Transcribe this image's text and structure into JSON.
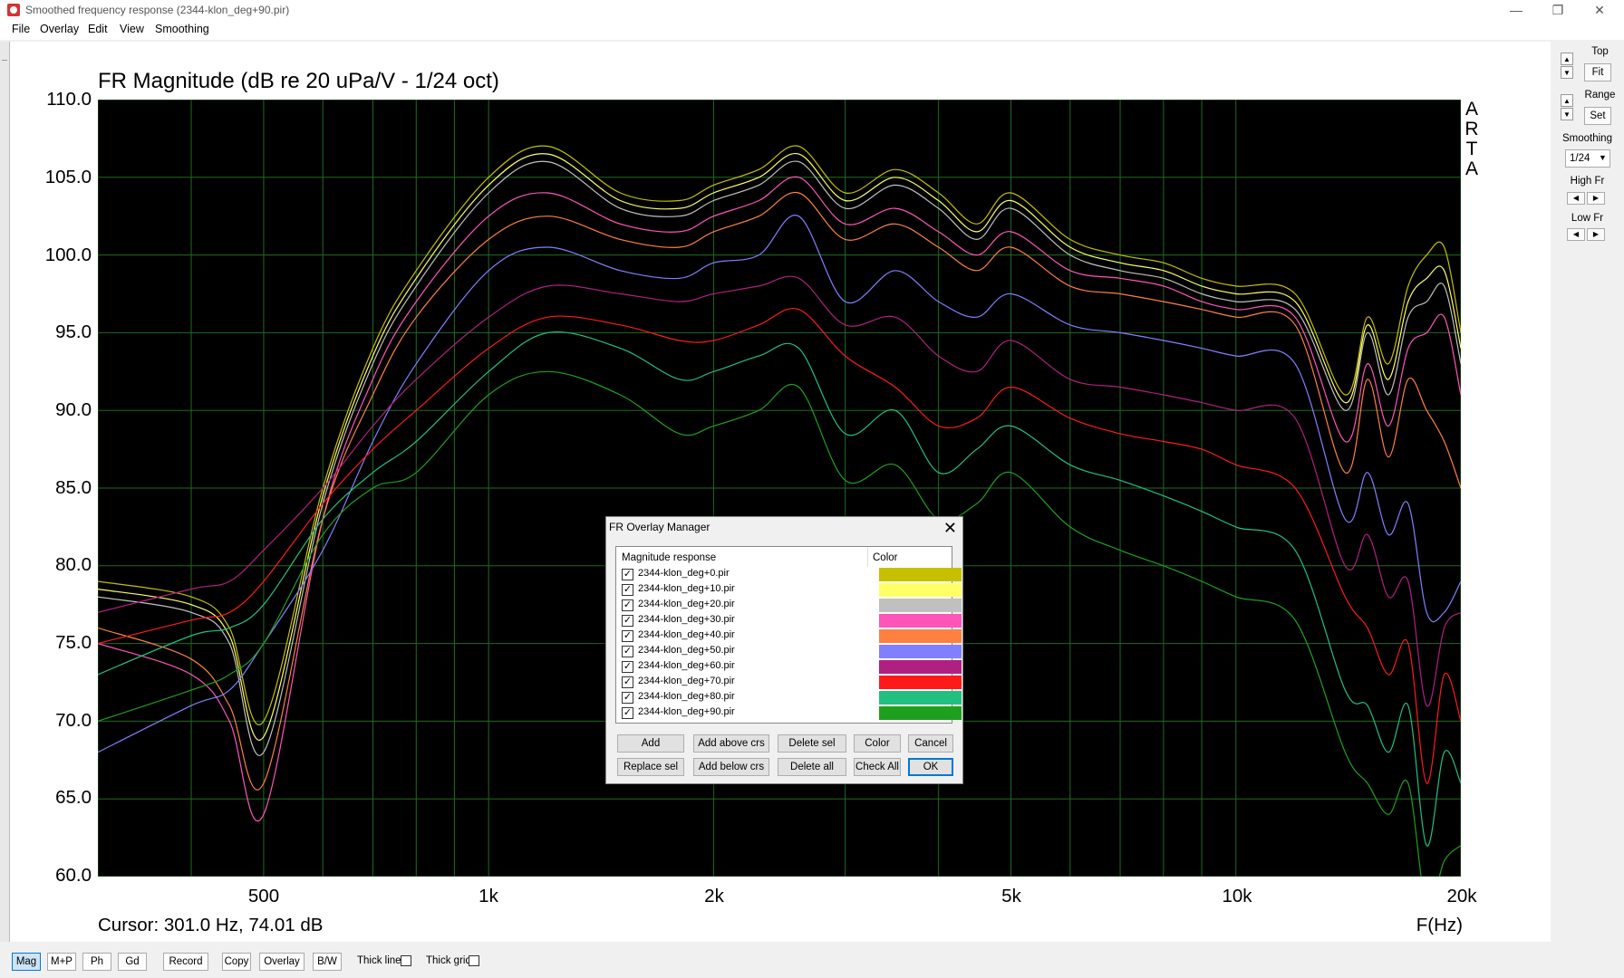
{
  "window": {
    "title": "Smoothed frequency response (2344-klon_deg+90.pir)",
    "minimize": "—",
    "restore": "❐",
    "close": "✕"
  },
  "menu": [
    "File",
    "Overlay",
    "Edit",
    "View",
    "Smoothing"
  ],
  "graph": {
    "title": "FR Magnitude (dB re 20 uPa/V - 1/24 oct)",
    "watermark": [
      "A",
      "R",
      "T",
      "A"
    ],
    "cursor_readout": "Cursor: 301.0 Hz, 74.01 dB",
    "x_unit": "F(Hz)"
  },
  "chart_data": {
    "type": "line",
    "title": "FR Magnitude (dB re 20 uPa/V - 1/24 oct)",
    "xlabel": "F(Hz)",
    "ylabel": "",
    "x_scale": "log",
    "xlim": [
      300,
      20000
    ],
    "ylim": [
      60,
      110
    ],
    "y_ticks": [
      "110.0",
      "105.0",
      "100.0",
      "95.0",
      "90.0",
      "85.0",
      "80.0",
      "75.0",
      "70.0",
      "65.0",
      "60.0"
    ],
    "x_ticks": [
      {
        "value": 500,
        "label": "500"
      },
      {
        "value": 1000,
        "label": "1k"
      },
      {
        "value": 2000,
        "label": "2k"
      },
      {
        "value": 5000,
        "label": "5k"
      },
      {
        "value": 10000,
        "label": "10k"
      },
      {
        "value": 20000,
        "label": "20k"
      }
    ],
    "grid": true,
    "background": "#000000",
    "grid_color": "#1f6b1f",
    "x": [
      300,
      400,
      450,
      500,
      600,
      700,
      800,
      1000,
      1200,
      1500,
      1800,
      2000,
      2300,
      2600,
      3000,
      3500,
      4000,
      4500,
      5000,
      6000,
      7000,
      8000,
      9000,
      10000,
      12000,
      14000,
      15000,
      16000,
      17000,
      18000,
      19000,
      20000
    ],
    "series": [
      {
        "name": "2344-klon_deg+0.pir",
        "color": "#c6c000",
        "values": [
          79,
          78,
          76,
          70,
          85,
          94,
          99,
          105,
          107,
          104,
          103.5,
          104.5,
          105.5,
          107,
          104,
          105.5,
          104,
          102,
          104,
          101,
          100,
          99.5,
          98.5,
          98,
          97.5,
          91,
          96,
          93,
          98,
          100,
          100.5,
          95
        ]
      },
      {
        "name": "2344-klon_deg+10.pir",
        "color": "#ffff66",
        "values": [
          78.5,
          77.5,
          75.5,
          69,
          84.5,
          93.5,
          98.5,
          104.5,
          106.5,
          103.5,
          103,
          104,
          105,
          106.5,
          103.5,
          105,
          103.5,
          101.5,
          103.5,
          100.5,
          99.5,
          99,
          98,
          97.5,
          97,
          90.5,
          95.5,
          92,
          97,
          98.5,
          99,
          94
        ]
      },
      {
        "name": "2344-klon_deg+20.pir",
        "color": "#c0c0c0",
        "values": [
          78,
          77,
          75,
          68,
          84,
          93,
          98,
          104,
          106,
          103,
          102.5,
          103.5,
          104.5,
          106,
          103,
          104.5,
          103,
          101,
          103,
          100,
          99,
          98.5,
          97.5,
          97,
          96.5,
          90,
          95,
          91,
          96,
          97,
          98,
          93
        ]
      },
      {
        "name": "2344-klon_deg+30.pir",
        "color": "#ff55bb",
        "values": [
          75,
          73,
          70,
          64,
          83,
          92,
          97,
          102.5,
          104,
          102,
          101.5,
          102.5,
          103.5,
          105,
          102,
          103,
          101.5,
          100,
          101.5,
          99,
          98.5,
          98,
          97,
          96.5,
          96,
          88,
          93,
          89,
          94,
          95,
          96,
          91
        ]
      },
      {
        "name": "2344-klon_deg+40.pir",
        "color": "#ff8040",
        "values": [
          76,
          74,
          71,
          66,
          83,
          91,
          96,
          101,
          102.5,
          101,
          100.5,
          101.5,
          102.5,
          104,
          101,
          102,
          100.5,
          99,
          100.5,
          98,
          97.5,
          97,
          96.5,
          96,
          95.5,
          86,
          92,
          87,
          92,
          90,
          88,
          85
        ]
      },
      {
        "name": "2344-klon_deg+50.pir",
        "color": "#8080ff",
        "values": [
          68,
          71,
          72,
          75,
          81,
          88,
          93,
          99,
          100.5,
          99,
          98.5,
          99.5,
          100,
          102.5,
          97,
          99,
          97,
          96,
          97.5,
          95.5,
          95,
          94.5,
          94,
          93.5,
          93,
          83,
          86,
          82,
          84,
          77,
          77,
          79
        ]
      },
      {
        "name": "2344-klon_deg+60.pir",
        "color": "#b02080",
        "values": [
          77,
          78.5,
          79,
          81,
          85,
          89,
          92,
          96,
          98,
          97.5,
          97,
          97.5,
          98,
          98.5,
          95.5,
          96,
          93.5,
          92.5,
          94.5,
          92,
          91.5,
          91,
          90.5,
          90,
          89.5,
          80,
          82,
          78,
          79,
          71,
          76,
          77
        ]
      },
      {
        "name": "2344-klon_deg+70.pir",
        "color": "#ff1a1a",
        "values": [
          75,
          76.5,
          77,
          79,
          84,
          87.5,
          90,
          94,
          96,
          95.5,
          94.5,
          94.5,
          95.5,
          96.5,
          93.5,
          91.5,
          89,
          89.5,
          91.5,
          89.5,
          88.5,
          88,
          87.5,
          86.5,
          85,
          78,
          76,
          73,
          75,
          66,
          73,
          70
        ]
      },
      {
        "name": "2344-klon_deg+80.pir",
        "color": "#22c080",
        "values": [
          73,
          75.5,
          76,
          77.5,
          83,
          86,
          88,
          92.5,
          95,
          94,
          92,
          92.5,
          93.5,
          94,
          88.5,
          90,
          86,
          87.5,
          89,
          86.5,
          85.5,
          84.5,
          83.5,
          82.5,
          81,
          72,
          71,
          68,
          71,
          62,
          68,
          66
        ]
      },
      {
        "name": "2344-klon_deg+90.pir",
        "color": "#1ea01e",
        "values": [
          70,
          72,
          73,
          75,
          82,
          85,
          86,
          91,
          92.5,
          91,
          88.5,
          89,
          90,
          91.5,
          85.5,
          86.5,
          83,
          84,
          86,
          82.5,
          81,
          80,
          79,
          78,
          76.5,
          68,
          66,
          64,
          66,
          58,
          61,
          62
        ]
      }
    ]
  },
  "right_panel": {
    "top_label": "Top",
    "fit_label": "Fit",
    "range_label": "Range",
    "set_label": "Set",
    "smoothing_label": "Smoothing",
    "smoothing_value": "1/24",
    "high_fr_label": "High Fr",
    "low_fr_label": "Low Fr"
  },
  "bottom_bar": {
    "buttons": [
      "Mag",
      "M+P",
      "Ph",
      "Gd",
      "Record",
      "Copy",
      "Overlay",
      "B/W"
    ],
    "thick_line_label": "Thick line",
    "thick_grid_label": "Thick grid"
  },
  "dialog": {
    "title": "FR Overlay Manager",
    "close": "✕",
    "col_response": "Magnitude response",
    "col_color": "Color",
    "items": [
      {
        "name": "2344-klon_deg+0.pir",
        "color": "#c6c000",
        "checked": "✓"
      },
      {
        "name": "2344-klon_deg+10.pir",
        "color": "#ffff66",
        "checked": "✓"
      },
      {
        "name": "2344-klon_deg+20.pir",
        "color": "#c0c0c0",
        "checked": "✓"
      },
      {
        "name": "2344-klon_deg+30.pir",
        "color": "#ff55bb",
        "checked": "✓"
      },
      {
        "name": "2344-klon_deg+40.pir",
        "color": "#ff8040",
        "checked": "✓"
      },
      {
        "name": "2344-klon_deg+50.pir",
        "color": "#8080ff",
        "checked": "✓"
      },
      {
        "name": "2344-klon_deg+60.pir",
        "color": "#b02080",
        "checked": "✓"
      },
      {
        "name": "2344-klon_deg+70.pir",
        "color": "#ff1a1a",
        "checked": "✓"
      },
      {
        "name": "2344-klon_deg+80.pir",
        "color": "#22c080",
        "checked": "✓"
      },
      {
        "name": "2344-klon_deg+90.pir",
        "color": "#1ea01e",
        "checked": "✓"
      }
    ],
    "buttons": {
      "add": "Add",
      "add_above": "Add above crs",
      "delete_sel": "Delete sel",
      "color": "Color",
      "cancel": "Cancel",
      "replace_sel": "Replace sel",
      "add_below": "Add below crs",
      "delete_all": "Delete all",
      "check_all": "Check All",
      "ok": "OK"
    }
  }
}
